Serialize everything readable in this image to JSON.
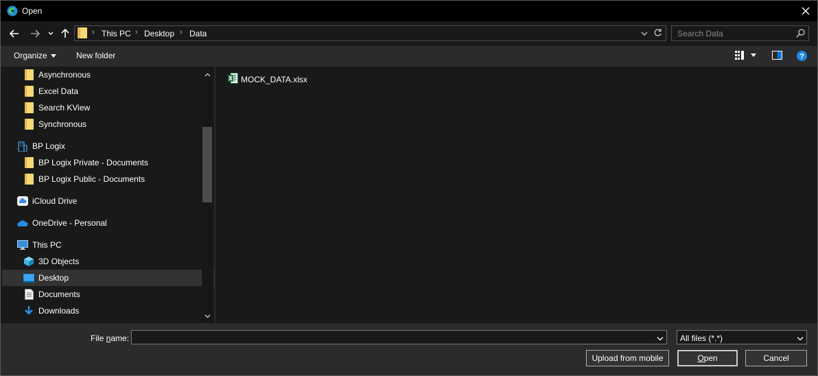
{
  "window": {
    "title": "Open"
  },
  "address": {
    "crumbs": [
      "This PC",
      "Desktop",
      "Data"
    ]
  },
  "search": {
    "placeholder": "Search Data"
  },
  "commands": {
    "organize": "Organize",
    "new_folder": "New folder"
  },
  "nav": {
    "items": [
      {
        "label": "Asynchronous",
        "icon": "folder-icon"
      },
      {
        "label": "Excel Data",
        "icon": "folder-icon"
      },
      {
        "label": "Search KView",
        "icon": "folder-icon"
      },
      {
        "label": "Synchronous",
        "icon": "folder-icon"
      },
      {
        "label": "BP Logix",
        "icon": "building-icon"
      },
      {
        "label": "BP Logix Private - Documents",
        "icon": "folder-icon"
      },
      {
        "label": "BP Logix Public - Documents",
        "icon": "folder-icon"
      },
      {
        "label": "iCloud Drive",
        "icon": "icloud-icon"
      },
      {
        "label": "OneDrive - Personal",
        "icon": "onedrive-icon"
      },
      {
        "label": "This PC",
        "icon": "computer-icon"
      },
      {
        "label": "3D Objects",
        "icon": "3d-objects-icon"
      },
      {
        "label": "Desktop",
        "icon": "desktop-icon",
        "selected": true
      },
      {
        "label": "Documents",
        "icon": "documents-icon"
      },
      {
        "label": "Downloads",
        "icon": "downloads-icon"
      }
    ]
  },
  "files": [
    {
      "name": "MOCK_DATA.xlsx",
      "icon": "excel-file-icon"
    }
  ],
  "bottom": {
    "filename_label_pre": "File ",
    "filename_label_ul": "n",
    "filename_label_post": "ame:",
    "filename_value": "",
    "file_type": "All files (*.*)",
    "upload_label": "Upload from mobile",
    "open_label_ul": "O",
    "open_label_rest": "pen",
    "cancel_label": "Cancel"
  },
  "colors": {
    "accent": "#0078d7",
    "folder": "#f8d775",
    "help": "#1e88e5",
    "excel": "#1d6f42"
  }
}
